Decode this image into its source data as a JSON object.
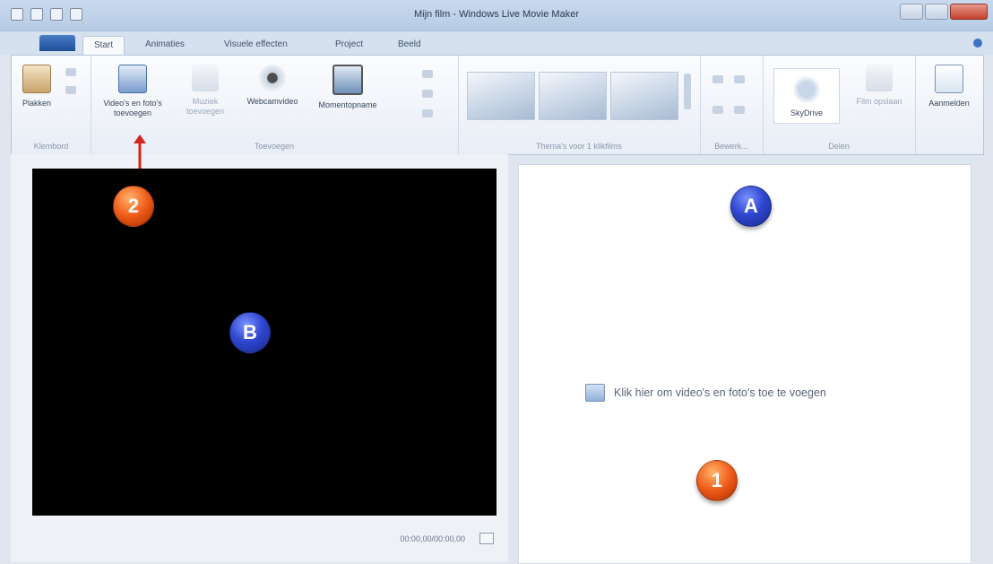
{
  "window": {
    "title": "Mijn film - Windows Live Movie Maker"
  },
  "tabs": [
    {
      "label": "Start"
    },
    {
      "label": "Animaties"
    },
    {
      "label": "Visuele effecten"
    },
    {
      "label": "Project"
    },
    {
      "label": "Beeld"
    }
  ],
  "ribbon": {
    "clipboard": {
      "paste_label": "Plakken",
      "group_label": "Klembord"
    },
    "add": {
      "add_video_label": "Video's en foto's toevoegen",
      "add_music_label": "Muziek toevoegen",
      "webcam_label": "Webcamvideo",
      "snapshot_label": "Momentopname",
      "group_label": "Toevoegen"
    },
    "themes": {
      "group_label": "Thema's voor 1 klikfilms"
    },
    "edit": {
      "group_label": "Bewerk..."
    },
    "share": {
      "skydrive_label": "SkyDrive",
      "more_label": "Film opslaan",
      "group_label": "Delen"
    },
    "signin": {
      "label": "Aanmelden"
    }
  },
  "player": {
    "timecode": "00:00,00/00:00,00"
  },
  "storyboard": {
    "add_hint": "Klik hier om video's en foto's toe te voegen"
  },
  "callouts": {
    "a": "A",
    "b": "B",
    "one": "1",
    "two": "2"
  }
}
